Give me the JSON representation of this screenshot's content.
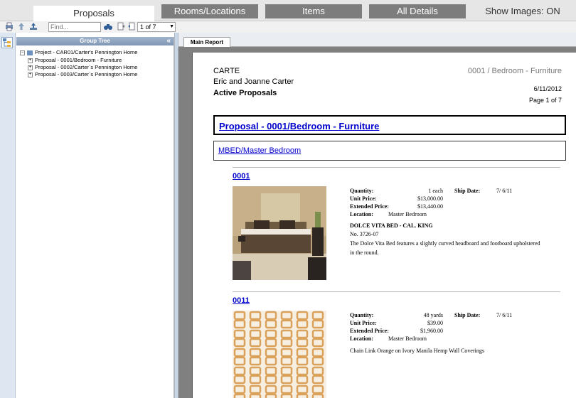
{
  "tabs": [
    {
      "label": "Proposals"
    },
    {
      "label": "Rooms/Locations"
    },
    {
      "label": "Items"
    },
    {
      "label": "All Details"
    }
  ],
  "show_images": "Show Images: ON",
  "toolbar": {
    "find_placeholder": "Find...",
    "page_value": "1 of 7",
    "icons": [
      "print-icon",
      "export-icon",
      "refresh-icon",
      "binoculars-icon",
      "first-page-icon",
      "prev-page-icon"
    ]
  },
  "group_tree": {
    "header": "Group Tree",
    "collapse": "«",
    "items": [
      {
        "label": "Project - CAR01/Carter's Pennington Home",
        "toggle": "−"
      },
      {
        "label": "Proposal - 0001/Bedroom - Furniture",
        "toggle": "+"
      },
      {
        "label": "Proposal - 0002/Carter`s Pennington Home",
        "toggle": "+"
      },
      {
        "label": "Proposal - 0003/Carter`s Pennington Home",
        "toggle": "+"
      }
    ]
  },
  "report": {
    "tab": "Main Report",
    "company": "CARTE",
    "client": "Eric and Joanne Carter",
    "title": "Active Proposals",
    "header_right": "0001 / Bedroom - Furniture",
    "date": "6/11/2012",
    "page_label": "Page 1 of 7",
    "proposal_link": "Proposal - 0001/Bedroom - Furniture",
    "room_link": "MBED/Master Bedroom",
    "labels": {
      "quantity": "Quantity:",
      "unit_price": "Unit Price:",
      "extended_price": "Extended Price:",
      "location": "Location:",
      "ship_date": "Ship Date:"
    },
    "items": [
      {
        "number": "0001",
        "quantity": "1 each",
        "unit_price": "$13,000.00",
        "extended_price": "$13,440.00",
        "location": "Master Bedroom",
        "ship_date": "7/ 6/11",
        "name": "DOLCE VITA BED - CAL. KING",
        "model": "No. 3726-07",
        "description": "The Dolce Vita Bed features a slightly curved headboard and footboard upholstered in the round."
      },
      {
        "number": "0011",
        "quantity": "48 yards",
        "unit_price": "$39.00",
        "extended_price": "$1,960.00",
        "location": "Master Bedroom",
        "ship_date": "7/ 6/11",
        "description": "Chain Link Orange on Ivory Manila Hemp Wall Coverings"
      }
    ]
  }
}
